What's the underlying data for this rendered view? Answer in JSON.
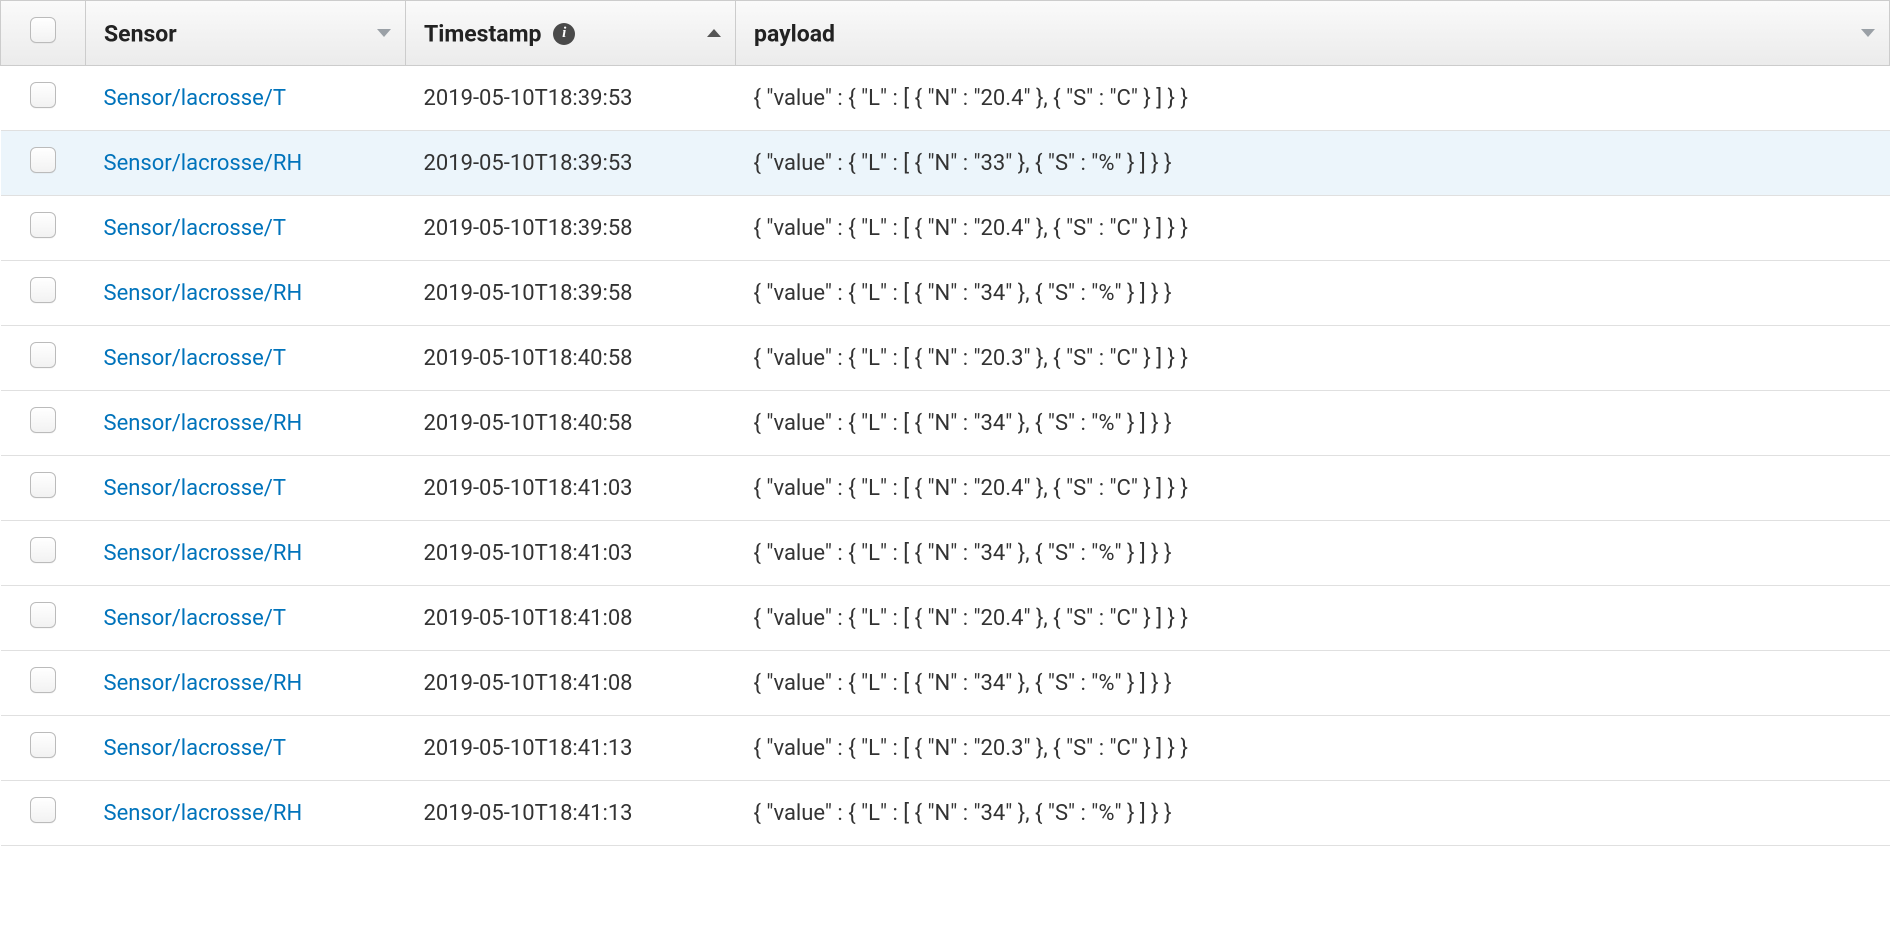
{
  "table": {
    "columns": {
      "sensor": "Sensor",
      "timestamp": "Timestamp",
      "payload": "payload"
    },
    "rows": [
      {
        "sensor": "Sensor/lacrosse/T",
        "timestamp": "2019-05-10T18:39:53",
        "payload": "{ \"value\" : { \"L\" : [ { \"N\" : \"20.4\" }, { \"S\" : \"C\" } ] } }",
        "highlight": false
      },
      {
        "sensor": "Sensor/lacrosse/RH",
        "timestamp": "2019-05-10T18:39:53",
        "payload": "{ \"value\" : { \"L\" : [ { \"N\" : \"33\" }, { \"S\" : \"%\" } ] } }",
        "highlight": true
      },
      {
        "sensor": "Sensor/lacrosse/T",
        "timestamp": "2019-05-10T18:39:58",
        "payload": "{ \"value\" : { \"L\" : [ { \"N\" : \"20.4\" }, { \"S\" : \"C\" } ] } }",
        "highlight": false
      },
      {
        "sensor": "Sensor/lacrosse/RH",
        "timestamp": "2019-05-10T18:39:58",
        "payload": "{ \"value\" : { \"L\" : [ { \"N\" : \"34\" }, { \"S\" : \"%\" } ] } }",
        "highlight": false
      },
      {
        "sensor": "Sensor/lacrosse/T",
        "timestamp": "2019-05-10T18:40:58",
        "payload": "{ \"value\" : { \"L\" : [ { \"N\" : \"20.3\" }, { \"S\" : \"C\" } ] } }",
        "highlight": false
      },
      {
        "sensor": "Sensor/lacrosse/RH",
        "timestamp": "2019-05-10T18:40:58",
        "payload": "{ \"value\" : { \"L\" : [ { \"N\" : \"34\" }, { \"S\" : \"%\" } ] } }",
        "highlight": false
      },
      {
        "sensor": "Sensor/lacrosse/T",
        "timestamp": "2019-05-10T18:41:03",
        "payload": "{ \"value\" : { \"L\" : [ { \"N\" : \"20.4\" }, { \"S\" : \"C\" } ] } }",
        "highlight": false
      },
      {
        "sensor": "Sensor/lacrosse/RH",
        "timestamp": "2019-05-10T18:41:03",
        "payload": "{ \"value\" : { \"L\" : [ { \"N\" : \"34\" }, { \"S\" : \"%\" } ] } }",
        "highlight": false
      },
      {
        "sensor": "Sensor/lacrosse/T",
        "timestamp": "2019-05-10T18:41:08",
        "payload": "{ \"value\" : { \"L\" : [ { \"N\" : \"20.4\" }, { \"S\" : \"C\" } ] } }",
        "highlight": false
      },
      {
        "sensor": "Sensor/lacrosse/RH",
        "timestamp": "2019-05-10T18:41:08",
        "payload": "{ \"value\" : { \"L\" : [ { \"N\" : \"34\" }, { \"S\" : \"%\" } ] } }",
        "highlight": false
      },
      {
        "sensor": "Sensor/lacrosse/T",
        "timestamp": "2019-05-10T18:41:13",
        "payload": "{ \"value\" : { \"L\" : [ { \"N\" : \"20.3\" }, { \"S\" : \"C\" } ] } }",
        "highlight": false
      },
      {
        "sensor": "Sensor/lacrosse/RH",
        "timestamp": "2019-05-10T18:41:13",
        "payload": "{ \"value\" : { \"L\" : [ { \"N\" : \"34\" }, { \"S\" : \"%\" } ] } }",
        "highlight": false
      }
    ]
  }
}
